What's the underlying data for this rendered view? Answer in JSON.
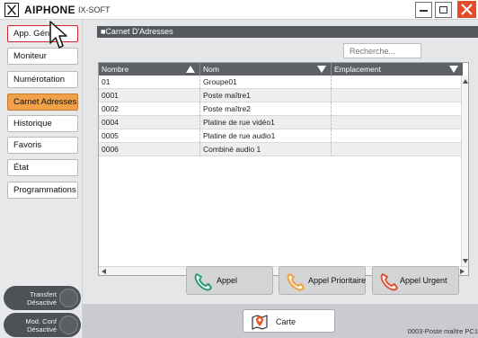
{
  "titlebar": {
    "brand": "AIPHONE",
    "product": "IX-SOFT"
  },
  "sidebar": {
    "items": [
      {
        "label": "App. Gén.",
        "state": "selected"
      },
      {
        "label": "Moniteur"
      },
      {
        "label": "Numérotation"
      },
      {
        "label": "Carnet Adresses",
        "state": "active"
      },
      {
        "label": "Historique"
      },
      {
        "label": "Favoris"
      },
      {
        "label": "État"
      },
      {
        "label": "Programmations"
      }
    ],
    "transfer": {
      "line1": "Transfert",
      "line2": "Désactivé"
    },
    "mod_conf": {
      "line1": "Mod. Conf",
      "line2": "Désactivé"
    }
  },
  "main": {
    "section_title": "■Carnet D'Adresses",
    "search_placeholder": "Recherche...",
    "table": {
      "columns": [
        "Nombre",
        "Nom",
        "Emplacement"
      ],
      "rows": [
        [
          "01",
          "Groupe01",
          ""
        ],
        [
          "0001",
          "Poste maître1",
          ""
        ],
        [
          "0002",
          "Poste maître2",
          ""
        ],
        [
          "0004",
          "Platine de rue vidéo1",
          ""
        ],
        [
          "0005",
          "Platine de rue audio1",
          ""
        ],
        [
          "0006",
          "Combiné audio 1",
          ""
        ]
      ]
    },
    "buttons": {
      "call": "Appel",
      "priority_call": "Appel Prioritaire",
      "urgent_call": "Appel Urgent"
    },
    "map_button": "Carte",
    "station_label": "0003-Poste maître PC1"
  },
  "colors": {
    "accent_orange": "#f0a14a",
    "header_dark": "#54585c",
    "selected_border": "#d4232b",
    "close_button": "#e24a2a",
    "call_green": "#2e9c7a",
    "priority_orange": "#f2a03a",
    "urgent_red": "#e0563a"
  },
  "icons": [
    "aiphone-logo-icon",
    "minimize-icon",
    "maximize-icon",
    "close-icon",
    "phone-handset-icon",
    "map-pin-icon",
    "mouse-cursor-icon"
  ]
}
